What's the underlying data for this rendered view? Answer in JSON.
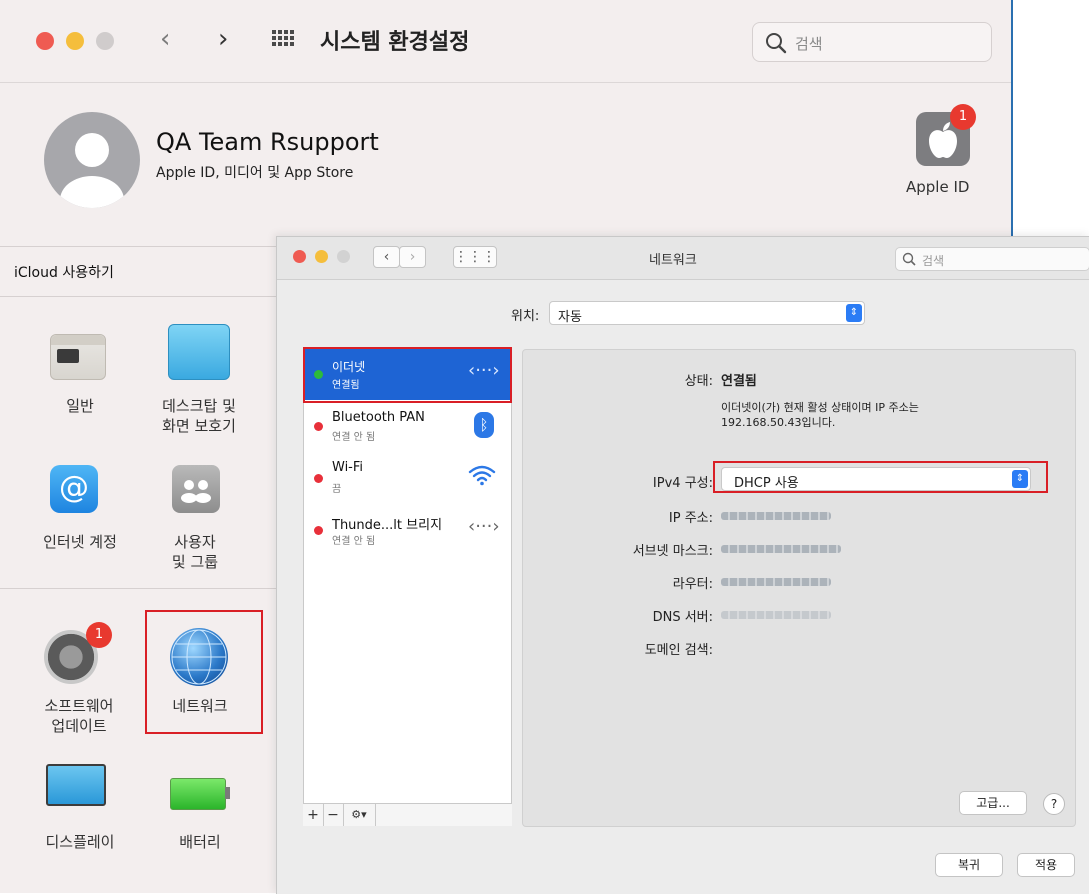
{
  "sysprefs": {
    "title": "시스템 환경설정",
    "search_placeholder": "검색",
    "account": {
      "name": "QA Team Rsupport",
      "subtitle": "Apple ID, 미디어 및 App Store",
      "appleid_label": "Apple ID",
      "appleid_badge": "1"
    },
    "icloud_label": "iCloud 사용하기",
    "panes": [
      {
        "label": "일반",
        "icon": "general-icon"
      },
      {
        "label": "데스크탑 및\n화면 보호기",
        "icon": "desktop-icon"
      },
      {
        "label": "인터넷 계정",
        "icon": "at-sign-icon"
      },
      {
        "label": "사용자\n및 그룹",
        "icon": "users-icon"
      },
      {
        "label": "소프트웨어\n업데이트",
        "icon": "gear-icon",
        "badge": "1"
      },
      {
        "label": "네트워크",
        "icon": "globe-icon"
      },
      {
        "label": "디스플레이",
        "icon": "display-icon"
      },
      {
        "label": "배터리",
        "icon": "battery-icon"
      }
    ]
  },
  "network": {
    "title": "네트워크",
    "search_placeholder": "검색",
    "location_label": "위치:",
    "location_value": "자동",
    "services": [
      {
        "name": "이더넷",
        "status": "연결됨",
        "status_color": "#2dbb3b",
        "icon": "ethernet-icon"
      },
      {
        "name": "Bluetooth PAN",
        "status": "연결 안 됨",
        "status_color": "#e8303a",
        "icon": "bluetooth-icon"
      },
      {
        "name": "Wi-Fi",
        "status": "끔",
        "status_color": "#e8303a",
        "icon": "wifi-icon"
      },
      {
        "name": "Thunde...lt 브리지",
        "status": "연결 안 됨",
        "status_color": "#e8303a",
        "icon": "thunderbolt-bridge-icon"
      }
    ],
    "toolbar": {
      "add": "+",
      "remove": "−",
      "action": "⚙▾"
    },
    "detail": {
      "status_label": "상태:",
      "status_value": "연결됨",
      "status_desc": "이더넷이(가) 현재 활성 상태이며 IP 주소는\n192.168.50.43입니다.",
      "ipv4_label": "IPv4 구성:",
      "ipv4_value": "DHCP 사용",
      "ip_label": "IP 주소:",
      "subnet_label": "서브넷 마스크:",
      "router_label": "라우터:",
      "dns_label": "DNS 서버:",
      "domain_label": "도메인 검색:",
      "advanced_button": "고급...",
      "help_button": "?"
    },
    "revert_button": "복귀",
    "apply_button": "적용"
  },
  "colors": {
    "accent": "#1e64d4",
    "highlight_box": "#d91f26"
  }
}
